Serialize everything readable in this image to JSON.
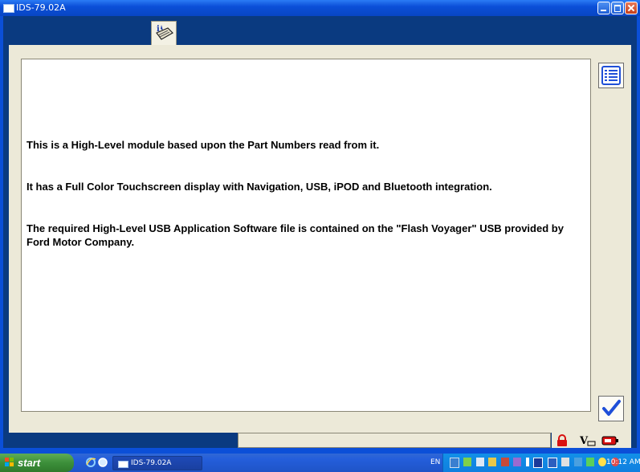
{
  "window": {
    "title": "IDS-79.02A"
  },
  "content": {
    "paragraphs": [
      "This is a High-Level module based upon the Part Numbers read from it.",
      "It has a Full Color Touchscreen display with Navigation, USB, iPOD and Bluetooth integration.",
      "The required High-Level USB Application Software file is contained on the \"Flash Voyager\" USB provided by Ford Motor Company."
    ]
  },
  "toolbar": {
    "tab_icon": "module-info-icon"
  },
  "side_buttons": {
    "list_icon": "list-icon",
    "confirm_icon": "checkmark-icon"
  },
  "status_icons": [
    "lock-icon",
    "vehicle-voltage-icon",
    "battery-icon"
  ],
  "taskbar": {
    "start_label": "start",
    "quick_launch": [
      "ie-icon",
      "ie-alt-icon"
    ],
    "task_label": "IDS-79.02A",
    "language": "EN",
    "clock": "10:12 AM"
  },
  "colors": {
    "accent": "#0a3a80",
    "check": "#1f4fd8",
    "lock": "#d81010"
  }
}
